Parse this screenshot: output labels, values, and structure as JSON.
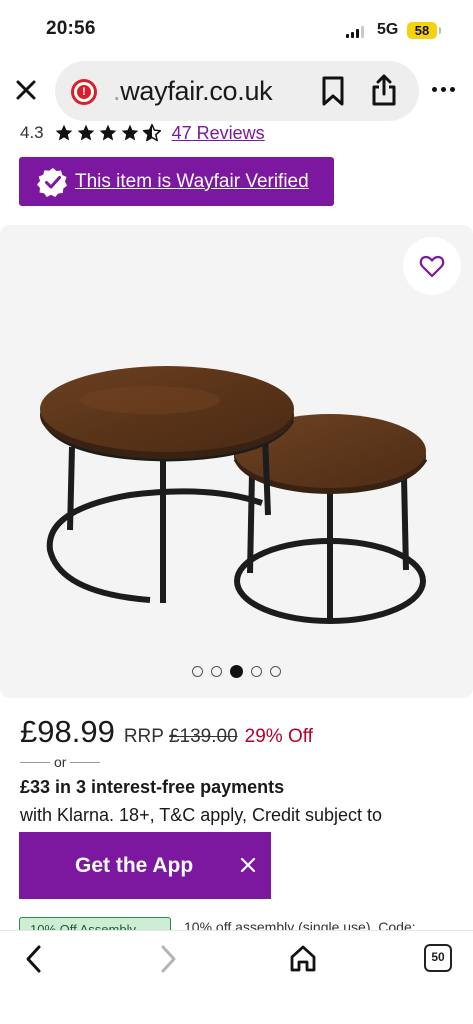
{
  "status_bar": {
    "time": "20:56",
    "network": "5G",
    "battery": "58"
  },
  "browser": {
    "url_faded": ".",
    "url": "wayfair.co.uk",
    "tab_count": "50"
  },
  "product": {
    "rating": "4.3",
    "stars_filled": 4.3,
    "reviews_link": "47 Reviews",
    "verified_text": "This item is Wayfair Verified",
    "image_count": 5,
    "active_image_index": 2
  },
  "pricing": {
    "price": "£98.99",
    "rrp_label": "RRP",
    "rrp": "£139.00",
    "discount": "29% Off",
    "or": "or",
    "klarna_title": "£33 in 3 interest-free payments",
    "klarna_sub": "with Klarna. 18+, T&C apply, Credit subject to"
  },
  "app_banner": {
    "label": "Get the App"
  },
  "promo": {
    "badge": "10% Off Assembly",
    "text": "10% off assembly (single use). Code:"
  },
  "colors": {
    "brand": "#7b189f",
    "discount": "#b3002d",
    "battery": "#f5d20b"
  }
}
